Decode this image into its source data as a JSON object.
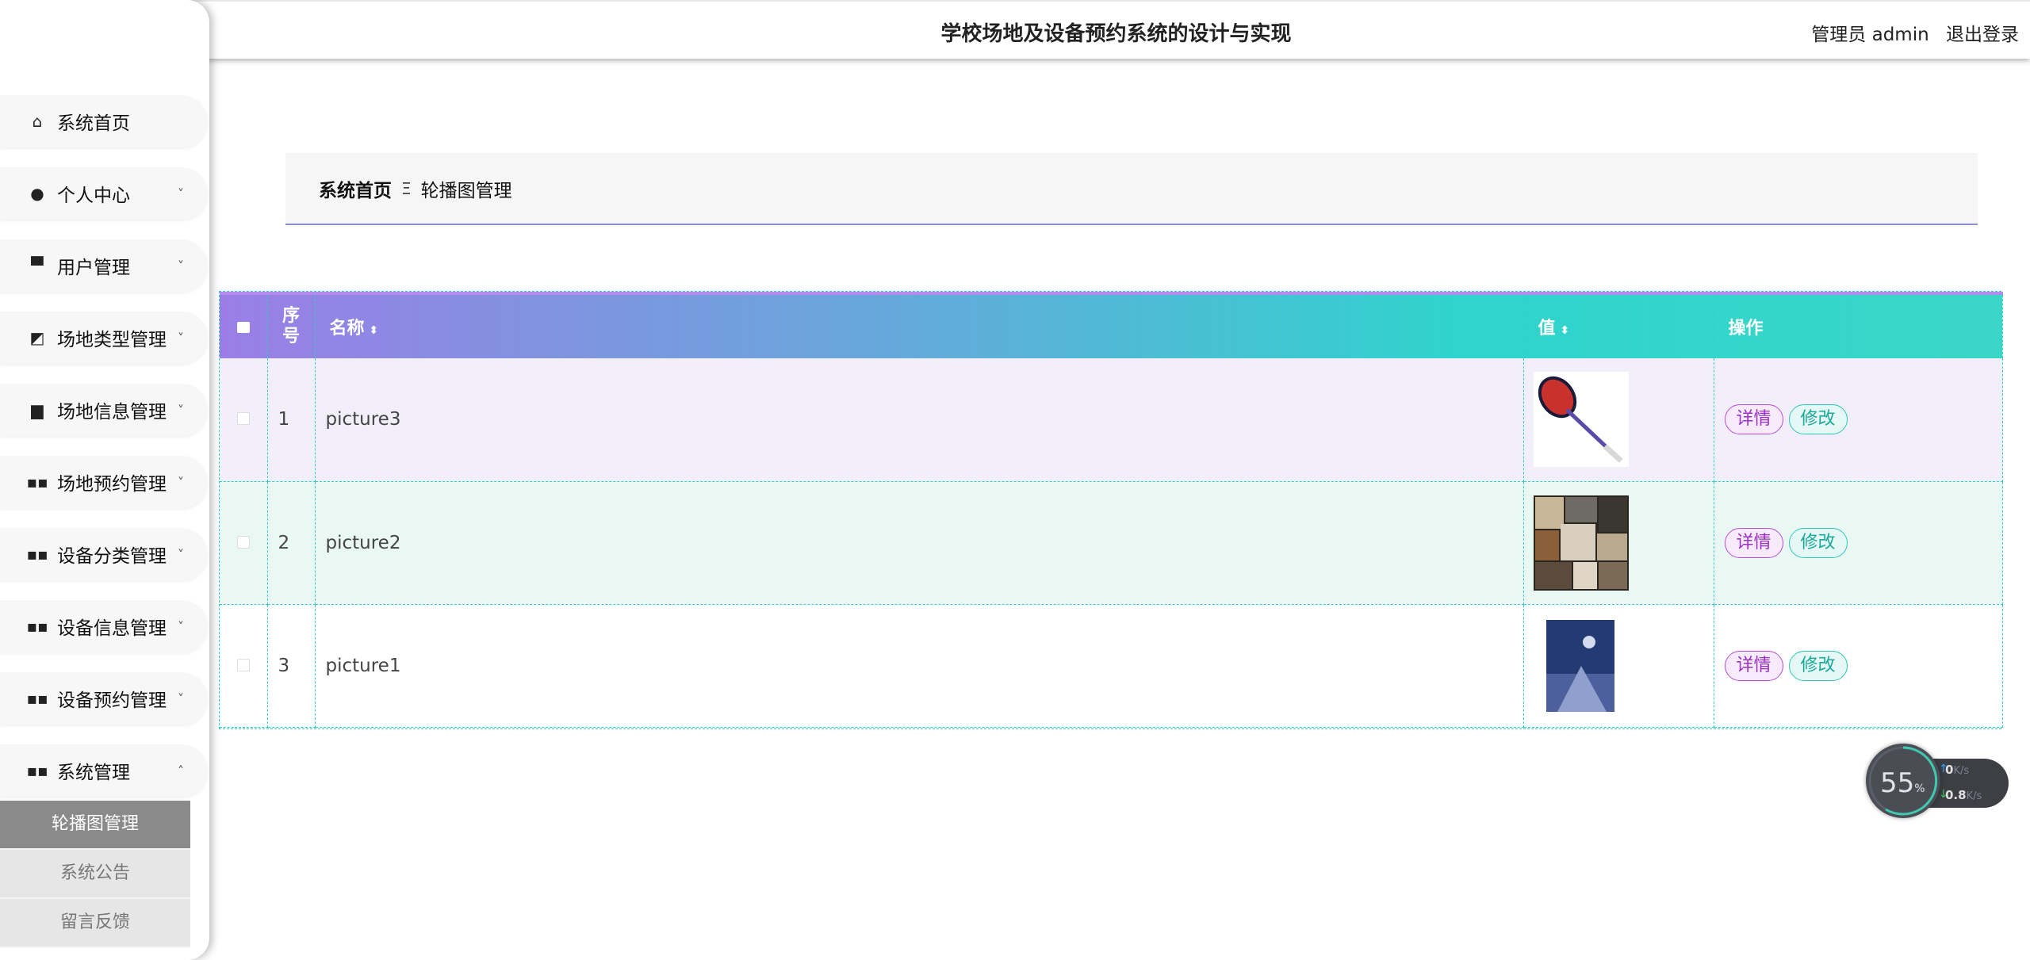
{
  "header": {
    "title": "学校场地及设备预约系统的设计与实现",
    "user": "管理员 admin",
    "logout": "退出登录"
  },
  "sidebar": {
    "items": [
      {
        "label": "系统首页",
        "icon": "home-icon",
        "arrow": ""
      },
      {
        "label": "个人中心",
        "icon": "user-icon",
        "arrow": "˅"
      },
      {
        "label": "用户管理",
        "icon": "monitor-icon",
        "arrow": "˅"
      },
      {
        "label": "场地类型管理",
        "icon": "chart-icon",
        "arrow": "˅"
      },
      {
        "label": "场地信息管理",
        "icon": "briefcase-icon",
        "arrow": "˅"
      },
      {
        "label": "场地预约管理",
        "icon": "grid-icon",
        "arrow": "˅"
      },
      {
        "label": "设备分类管理",
        "icon": "grid-icon",
        "arrow": "˅"
      },
      {
        "label": "设备信息管理",
        "icon": "grid-icon",
        "arrow": "˅"
      },
      {
        "label": "设备预约管理",
        "icon": "grid-icon",
        "arrow": "˅"
      },
      {
        "label": "系统管理",
        "icon": "grid-icon",
        "arrow": "˄"
      }
    ],
    "submenu": [
      "轮播图管理",
      "系统公告",
      "留言反馈"
    ]
  },
  "breadcrumb": {
    "home": "系统首页",
    "separator": "Ξ",
    "current": "轮播图管理"
  },
  "table": {
    "columns": {
      "index": "序号",
      "name": "名称",
      "value": "值",
      "actions": "操作"
    },
    "rows": [
      {
        "index": "1",
        "name": "picture3",
        "image": "badminton-racket-image"
      },
      {
        "index": "2",
        "name": "picture2",
        "image": "magazine-collage-image"
      },
      {
        "index": "3",
        "name": "picture1",
        "image": "book-cover-image"
      }
    ],
    "detail_label": "详情",
    "edit_label": "修改"
  },
  "net_widget": {
    "percent": "55",
    "percent_unit": "%",
    "up_value": "0",
    "down_value": "0.8",
    "unit": "K/s"
  },
  "colors": {
    "header_gradient_start": "#9a7ee6",
    "header_gradient_end": "#2fd4cd",
    "detail_button": "#9b30c8",
    "edit_button": "#1aa99a",
    "submenu_active": "#8a8a8a"
  }
}
